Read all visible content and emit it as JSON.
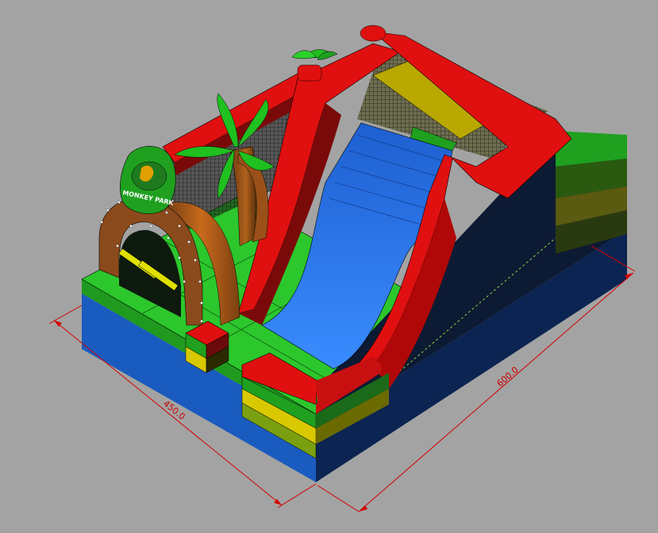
{
  "viewport": {
    "background": "#a3a3a3",
    "model": "inflatable-jungle-slide"
  },
  "sign": {
    "text": "MONKEY PARK"
  },
  "dimensions": {
    "width_label": "450.0",
    "length_label": "600.0",
    "line_color": "#d40000"
  },
  "colors": {
    "base_blue": "#1a5bbf",
    "green": "#1fb51f",
    "red": "#e01010",
    "yellow": "#d8c800",
    "slide_blue": "#2a7cf0",
    "dark_side": "#0d1a33",
    "brown": "#8b4a1c"
  }
}
